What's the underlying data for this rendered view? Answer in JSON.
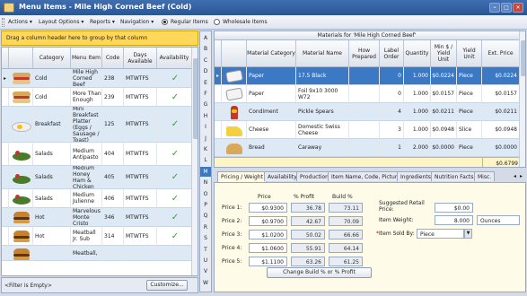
{
  "window": {
    "title": "Menu Items - Mile High Corned Beef (Cold)"
  },
  "toolbar": {
    "actions": "Actions ▾",
    "layout_options": "Layout Options ▾",
    "reports": "Reports ▾",
    "navigation": "Navigation ▾",
    "regular_items": "Regular Items",
    "wholesale_items": "Wholesale Items"
  },
  "grid": {
    "group_hint": "Drag a column header here to group by that column",
    "headers": {
      "category": "Category",
      "menu_item": "Menu Item",
      "code": "Code",
      "days": "Days Available",
      "availability": "Availability"
    },
    "rows": [
      {
        "category": "Cold",
        "menu_item": "Mile High Corned Beef",
        "code": "238",
        "days": "MTWTFS",
        "avail": "✓",
        "icon": "sandwich-icon"
      },
      {
        "category": "Cold",
        "menu_item": "More Than Enough",
        "code": "239",
        "days": "MTWTFS",
        "avail": "✓",
        "icon": "sandwich-icon"
      },
      {
        "category": "Breakfast",
        "menu_item": "Mini Breakfast Platter (Eggs / Sausage / Toast)",
        "code": "125",
        "days": "MTWTFS",
        "avail": "✓",
        "icon": "egg-platter-icon"
      },
      {
        "category": "Salads",
        "menu_item": "Medium Antipasto",
        "code": "404",
        "days": "MTWTFS",
        "avail": "✓",
        "icon": "salad-icon"
      },
      {
        "category": "Salads",
        "menu_item": "Medium Honey Ham & Chicken",
        "code": "405",
        "days": "MTWTFS",
        "avail": "✓",
        "icon": "salad-icon"
      },
      {
        "category": "Salads",
        "menu_item": "Medium Julienne",
        "code": "406",
        "days": "MTWTFS",
        "avail": "✓",
        "icon": "salad-icon"
      },
      {
        "category": "Hot",
        "menu_item": "Marvelous Monte Cristo",
        "code": "346",
        "days": "MTWTFS",
        "avail": "✓",
        "icon": "burger-icon"
      },
      {
        "category": "Hot",
        "menu_item": "Meatball Jr. Sub",
        "code": "314",
        "days": "MTWTFS",
        "avail": "✓",
        "icon": "burger-icon"
      },
      {
        "category": "",
        "menu_item": "Meatball,",
        "code": "",
        "days": "",
        "avail": "",
        "icon": "burger-icon"
      }
    ],
    "filter_text": "<Filter is Empty>",
    "customize_label": "Customize..."
  },
  "letters": [
    "A",
    "B",
    "C",
    "D",
    "E",
    "F",
    "G",
    "H",
    "I",
    "J",
    "K",
    "L",
    "M",
    "N",
    "O",
    "P",
    "Q",
    "R",
    "S",
    "T",
    "U",
    "V",
    "W"
  ],
  "materials": {
    "title": "Materials for 'Mile High Corned Beef'",
    "headers": {
      "category": "Material Category",
      "name": "Material Name",
      "how": "How Prepared",
      "order": "Label Order",
      "qty": "Quantity",
      "min": "Min $ / Yield Unit",
      "unit": "Yield Unit",
      "price": "Ext. Price"
    },
    "rows": [
      {
        "category": "Paper",
        "name": "17.5 Black",
        "how": "",
        "order": "0",
        "qty": "1.000",
        "min": "$0.0224",
        "unit": "Piece",
        "price": "$0.0224",
        "icon": "paper-icon"
      },
      {
        "category": "Paper",
        "name": "Foil 9x10 3000 W72",
        "how": "",
        "order": "0",
        "qty": "1.000",
        "min": "$0.0157",
        "unit": "Piece",
        "price": "$0.0157",
        "icon": "paper-icon"
      },
      {
        "category": "Condiment",
        "name": "Pickle Spears",
        "how": "",
        "order": "4",
        "qty": "1.000",
        "min": "$0.0211",
        "unit": "Piece",
        "price": "$0.0211",
        "icon": "condiment-icon"
      },
      {
        "category": "Cheese",
        "name": "Domestic Swiss Cheese",
        "how": "",
        "order": "3",
        "qty": "1.000",
        "min": "$0.0948",
        "unit": "Slice",
        "price": "$0.0948",
        "icon": "cheese-icon"
      },
      {
        "category": "Bread",
        "name": "Caraway",
        "how": "",
        "order": "1",
        "qty": "2.000",
        "min": "$0.0000",
        "unit": "Piece",
        "price": "$0.0000",
        "icon": "bread-icon"
      }
    ],
    "total": "$0.6799"
  },
  "tabs": [
    "Pricing / Weight",
    "Availability",
    "Production",
    "Item Name, Code, Picture",
    "Ingredients",
    "Nutrition Facts",
    "Misc."
  ],
  "pricing": {
    "col_price": "Price",
    "col_profit": "% Profit",
    "col_build": "Build %",
    "rows": [
      {
        "label": "Price 1:",
        "price": "$0.9300",
        "profit": "36.78",
        "build": "73.11"
      },
      {
        "label": "Price 2:",
        "price": "$0.9700",
        "profit": "42.67",
        "build": "70.09"
      },
      {
        "label": "Price 3:",
        "price": "$1.0200",
        "profit": "50.02",
        "build": "66.66"
      },
      {
        "label": "Price 4:",
        "price": "$1.0600",
        "profit": "55.91",
        "build": "64.14"
      },
      {
        "label": "Price 5:",
        "price": "$1.1100",
        "profit": "63.26",
        "build": "61.25"
      }
    ],
    "change_button": "Change Build % or % Profit",
    "suggested_label": "Suggested Retail Price:",
    "suggested_value": "$0.00",
    "weight_label": "Item Weight:",
    "weight_value": "8.000",
    "weight_unit": "Ounces",
    "sold_by_label": "Item Sold By:",
    "sold_by_value": "Piece"
  }
}
